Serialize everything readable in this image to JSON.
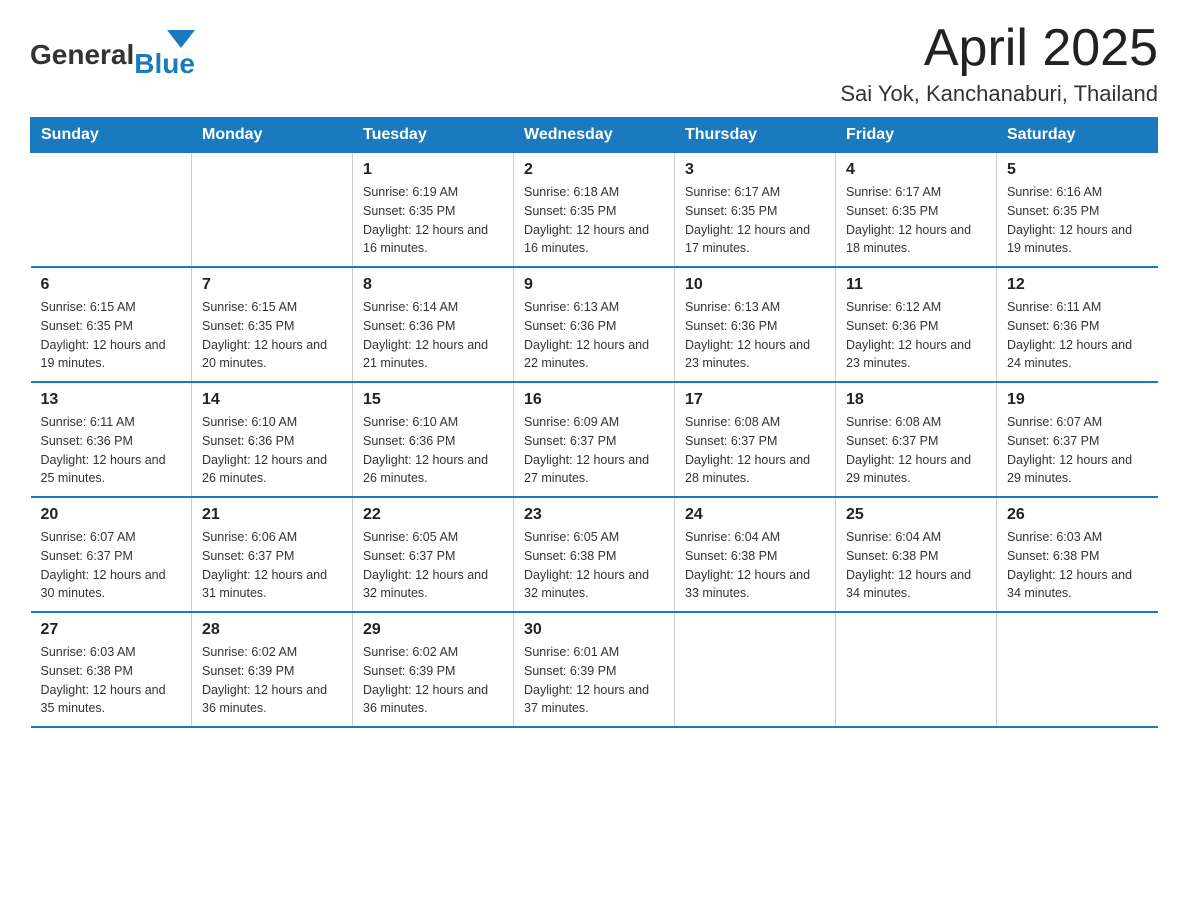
{
  "header": {
    "logo_general": "General",
    "logo_blue": "Blue",
    "month_title": "April 2025",
    "location": "Sai Yok, Kanchanaburi, Thailand"
  },
  "calendar": {
    "headers": [
      "Sunday",
      "Monday",
      "Tuesday",
      "Wednesday",
      "Thursday",
      "Friday",
      "Saturday"
    ],
    "weeks": [
      [
        {
          "day": "",
          "sunrise": "",
          "sunset": "",
          "daylight": ""
        },
        {
          "day": "",
          "sunrise": "",
          "sunset": "",
          "daylight": ""
        },
        {
          "day": "1",
          "sunrise": "Sunrise: 6:19 AM",
          "sunset": "Sunset: 6:35 PM",
          "daylight": "Daylight: 12 hours and 16 minutes."
        },
        {
          "day": "2",
          "sunrise": "Sunrise: 6:18 AM",
          "sunset": "Sunset: 6:35 PM",
          "daylight": "Daylight: 12 hours and 16 minutes."
        },
        {
          "day": "3",
          "sunrise": "Sunrise: 6:17 AM",
          "sunset": "Sunset: 6:35 PM",
          "daylight": "Daylight: 12 hours and 17 minutes."
        },
        {
          "day": "4",
          "sunrise": "Sunrise: 6:17 AM",
          "sunset": "Sunset: 6:35 PM",
          "daylight": "Daylight: 12 hours and 18 minutes."
        },
        {
          "day": "5",
          "sunrise": "Sunrise: 6:16 AM",
          "sunset": "Sunset: 6:35 PM",
          "daylight": "Daylight: 12 hours and 19 minutes."
        }
      ],
      [
        {
          "day": "6",
          "sunrise": "Sunrise: 6:15 AM",
          "sunset": "Sunset: 6:35 PM",
          "daylight": "Daylight: 12 hours and 19 minutes."
        },
        {
          "day": "7",
          "sunrise": "Sunrise: 6:15 AM",
          "sunset": "Sunset: 6:35 PM",
          "daylight": "Daylight: 12 hours and 20 minutes."
        },
        {
          "day": "8",
          "sunrise": "Sunrise: 6:14 AM",
          "sunset": "Sunset: 6:36 PM",
          "daylight": "Daylight: 12 hours and 21 minutes."
        },
        {
          "day": "9",
          "sunrise": "Sunrise: 6:13 AM",
          "sunset": "Sunset: 6:36 PM",
          "daylight": "Daylight: 12 hours and 22 minutes."
        },
        {
          "day": "10",
          "sunrise": "Sunrise: 6:13 AM",
          "sunset": "Sunset: 6:36 PM",
          "daylight": "Daylight: 12 hours and 23 minutes."
        },
        {
          "day": "11",
          "sunrise": "Sunrise: 6:12 AM",
          "sunset": "Sunset: 6:36 PM",
          "daylight": "Daylight: 12 hours and 23 minutes."
        },
        {
          "day": "12",
          "sunrise": "Sunrise: 6:11 AM",
          "sunset": "Sunset: 6:36 PM",
          "daylight": "Daylight: 12 hours and 24 minutes."
        }
      ],
      [
        {
          "day": "13",
          "sunrise": "Sunrise: 6:11 AM",
          "sunset": "Sunset: 6:36 PM",
          "daylight": "Daylight: 12 hours and 25 minutes."
        },
        {
          "day": "14",
          "sunrise": "Sunrise: 6:10 AM",
          "sunset": "Sunset: 6:36 PM",
          "daylight": "Daylight: 12 hours and 26 minutes."
        },
        {
          "day": "15",
          "sunrise": "Sunrise: 6:10 AM",
          "sunset": "Sunset: 6:36 PM",
          "daylight": "Daylight: 12 hours and 26 minutes."
        },
        {
          "day": "16",
          "sunrise": "Sunrise: 6:09 AM",
          "sunset": "Sunset: 6:37 PM",
          "daylight": "Daylight: 12 hours and 27 minutes."
        },
        {
          "day": "17",
          "sunrise": "Sunrise: 6:08 AM",
          "sunset": "Sunset: 6:37 PM",
          "daylight": "Daylight: 12 hours and 28 minutes."
        },
        {
          "day": "18",
          "sunrise": "Sunrise: 6:08 AM",
          "sunset": "Sunset: 6:37 PM",
          "daylight": "Daylight: 12 hours and 29 minutes."
        },
        {
          "day": "19",
          "sunrise": "Sunrise: 6:07 AM",
          "sunset": "Sunset: 6:37 PM",
          "daylight": "Daylight: 12 hours and 29 minutes."
        }
      ],
      [
        {
          "day": "20",
          "sunrise": "Sunrise: 6:07 AM",
          "sunset": "Sunset: 6:37 PM",
          "daylight": "Daylight: 12 hours and 30 minutes."
        },
        {
          "day": "21",
          "sunrise": "Sunrise: 6:06 AM",
          "sunset": "Sunset: 6:37 PM",
          "daylight": "Daylight: 12 hours and 31 minutes."
        },
        {
          "day": "22",
          "sunrise": "Sunrise: 6:05 AM",
          "sunset": "Sunset: 6:37 PM",
          "daylight": "Daylight: 12 hours and 32 minutes."
        },
        {
          "day": "23",
          "sunrise": "Sunrise: 6:05 AM",
          "sunset": "Sunset: 6:38 PM",
          "daylight": "Daylight: 12 hours and 32 minutes."
        },
        {
          "day": "24",
          "sunrise": "Sunrise: 6:04 AM",
          "sunset": "Sunset: 6:38 PM",
          "daylight": "Daylight: 12 hours and 33 minutes."
        },
        {
          "day": "25",
          "sunrise": "Sunrise: 6:04 AM",
          "sunset": "Sunset: 6:38 PM",
          "daylight": "Daylight: 12 hours and 34 minutes."
        },
        {
          "day": "26",
          "sunrise": "Sunrise: 6:03 AM",
          "sunset": "Sunset: 6:38 PM",
          "daylight": "Daylight: 12 hours and 34 minutes."
        }
      ],
      [
        {
          "day": "27",
          "sunrise": "Sunrise: 6:03 AM",
          "sunset": "Sunset: 6:38 PM",
          "daylight": "Daylight: 12 hours and 35 minutes."
        },
        {
          "day": "28",
          "sunrise": "Sunrise: 6:02 AM",
          "sunset": "Sunset: 6:39 PM",
          "daylight": "Daylight: 12 hours and 36 minutes."
        },
        {
          "day": "29",
          "sunrise": "Sunrise: 6:02 AM",
          "sunset": "Sunset: 6:39 PM",
          "daylight": "Daylight: 12 hours and 36 minutes."
        },
        {
          "day": "30",
          "sunrise": "Sunrise: 6:01 AM",
          "sunset": "Sunset: 6:39 PM",
          "daylight": "Daylight: 12 hours and 37 minutes."
        },
        {
          "day": "",
          "sunrise": "",
          "sunset": "",
          "daylight": ""
        },
        {
          "day": "",
          "sunrise": "",
          "sunset": "",
          "daylight": ""
        },
        {
          "day": "",
          "sunrise": "",
          "sunset": "",
          "daylight": ""
        }
      ]
    ]
  }
}
